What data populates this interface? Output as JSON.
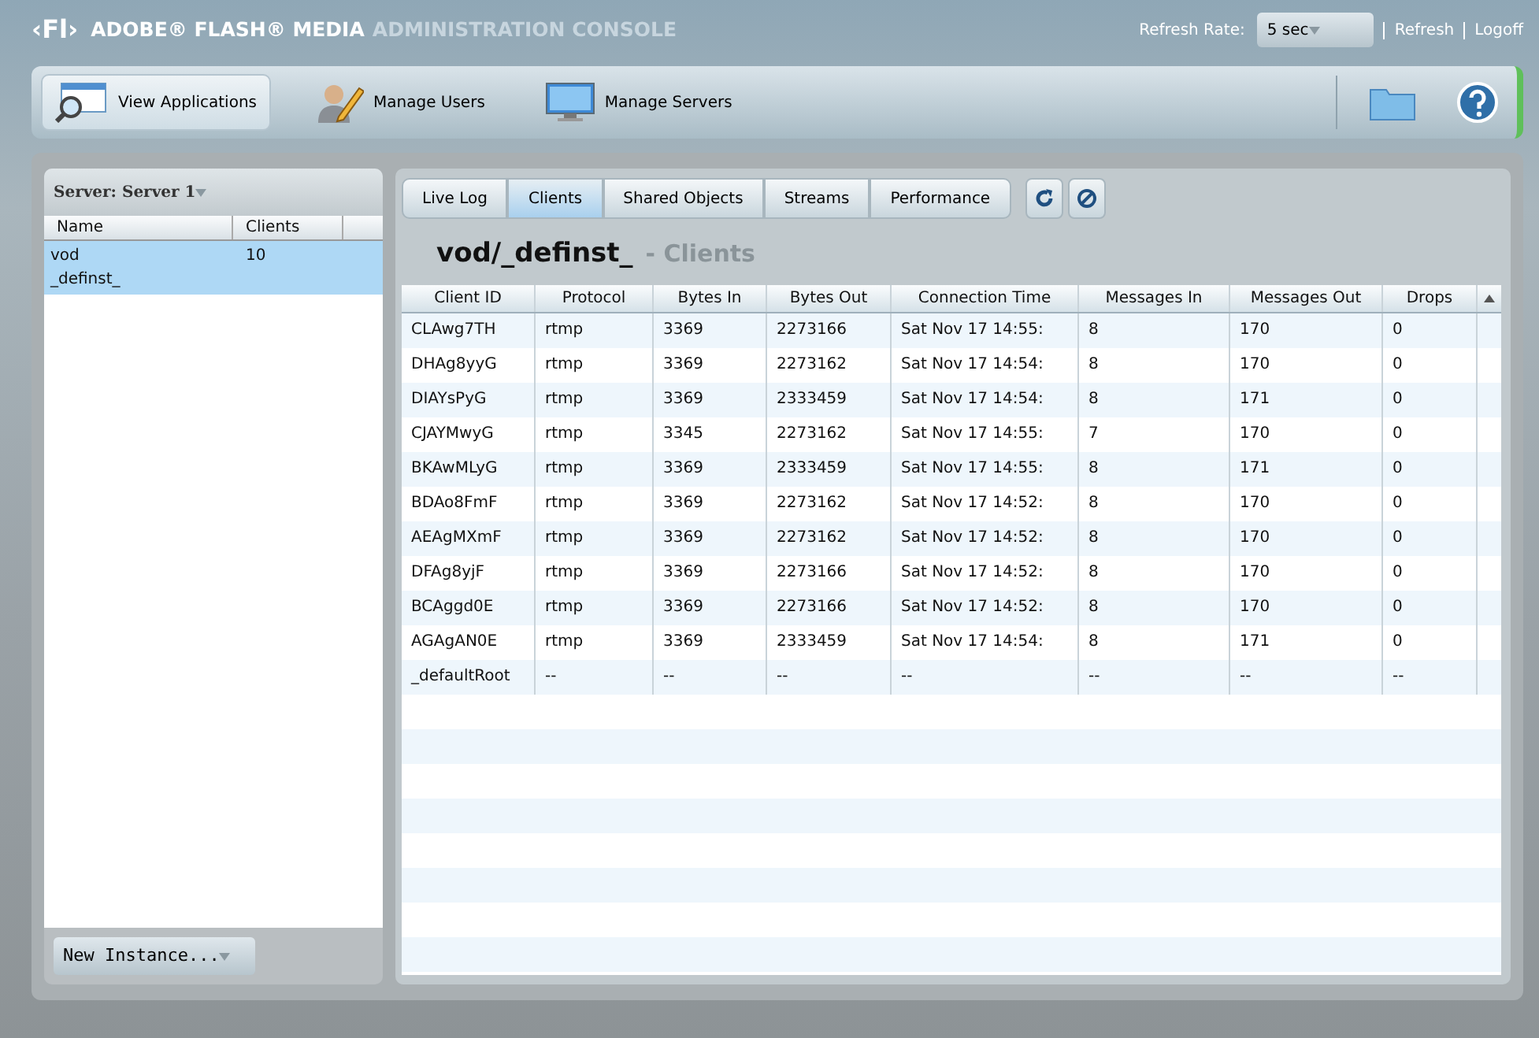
{
  "header": {
    "logo": "‹Fl›",
    "brand": "ADOBE® FLASH® MEDIA",
    "product": "ADMINISTRATION CONSOLE",
    "refresh_rate_label": "Refresh Rate:",
    "refresh_rate": "5 sec",
    "links": [
      "Refresh",
      "Logoff"
    ]
  },
  "nav": [
    {
      "label": "View Applications",
      "kind": "applications",
      "selected": true
    },
    {
      "label": "Manage Users",
      "kind": "users",
      "selected": false
    },
    {
      "label": "Manage Servers",
      "kind": "servers",
      "selected": false
    }
  ],
  "left_panel": {
    "server": "Server: Server 1",
    "columns": [
      "Name",
      "Clients"
    ],
    "rows": [
      {
        "name": "vod\n_definst_",
        "clients": "10",
        "selected": true
      }
    ],
    "new_instance": "New Instance..."
  },
  "tabs": [
    {
      "label": "Live Log",
      "selected": false
    },
    {
      "label": "Clients",
      "selected": true
    },
    {
      "label": "Shared Objects",
      "selected": false
    },
    {
      "label": "Streams",
      "selected": false
    },
    {
      "label": "Performance",
      "selected": false
    }
  ],
  "title": "vod/_definst_",
  "subtitle": "- Clients",
  "table": {
    "columns": [
      "Client ID",
      "Protocol",
      "Bytes In",
      "Bytes Out",
      "Connection Time",
      "Messages In",
      "Messages Out",
      "Drops"
    ],
    "rows": [
      [
        "CLAwg7TH",
        "rtmp",
        "3369",
        "2273166",
        "Sat Nov 17 14:55:",
        "8",
        "170",
        "0"
      ],
      [
        "DHAg8yyG",
        "rtmp",
        "3369",
        "2273162",
        "Sat Nov 17 14:54:",
        "8",
        "170",
        "0"
      ],
      [
        "DIAYsPyG",
        "rtmp",
        "3369",
        "2333459",
        "Sat Nov 17 14:54:",
        "8",
        "171",
        "0"
      ],
      [
        "CJAYMwyG",
        "rtmp",
        "3345",
        "2273162",
        "Sat Nov 17 14:55:",
        "7",
        "170",
        "0"
      ],
      [
        "BKAwMLyG",
        "rtmp",
        "3369",
        "2333459",
        "Sat Nov 17 14:55:",
        "8",
        "171",
        "0"
      ],
      [
        "BDAo8FmF",
        "rtmp",
        "3369",
        "2273162",
        "Sat Nov 17 14:52:",
        "8",
        "170",
        "0"
      ],
      [
        "AEAgMXmF",
        "rtmp",
        "3369",
        "2273162",
        "Sat Nov 17 14:52:",
        "8",
        "170",
        "0"
      ],
      [
        "DFAg8yjF",
        "rtmp",
        "3369",
        "2273166",
        "Sat Nov 17 14:52:",
        "8",
        "170",
        "0"
      ],
      [
        "BCAggd0E",
        "rtmp",
        "3369",
        "2273166",
        "Sat Nov 17 14:52:",
        "8",
        "170",
        "0"
      ],
      [
        "AGAgAN0E",
        "rtmp",
        "3369",
        "2333459",
        "Sat Nov 17 14:54:",
        "8",
        "171",
        "0"
      ],
      [
        "_defaultRoot",
        "--",
        "--",
        "--",
        "--",
        "--",
        "--",
        "--"
      ]
    ]
  }
}
